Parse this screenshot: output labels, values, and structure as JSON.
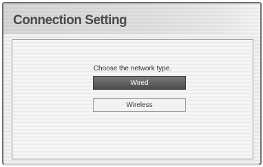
{
  "dialog": {
    "title": "Connection Setting",
    "prompt": "Choose the network type.",
    "options": [
      {
        "label": "Wired",
        "selected": true
      },
      {
        "label": "Wireless",
        "selected": false
      }
    ]
  }
}
